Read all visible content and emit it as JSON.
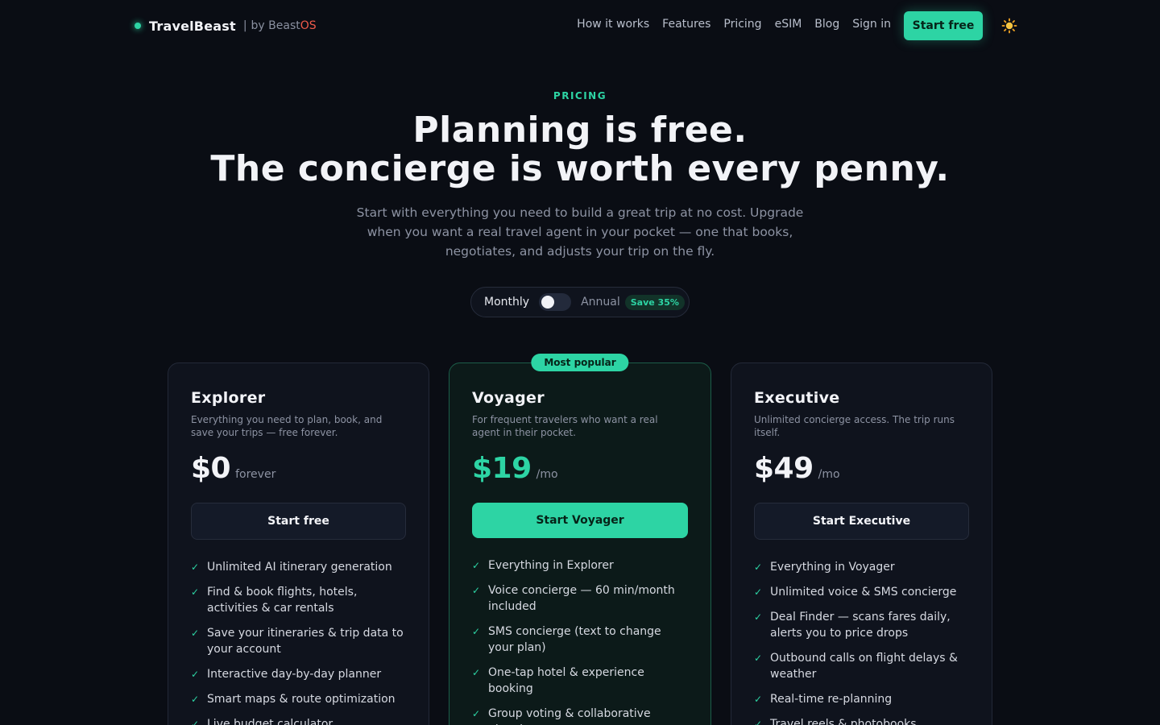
{
  "nav": {
    "brand": "TravelBeast",
    "separator": "|",
    "by_prefix": "by Beast",
    "by_suffix": "OS",
    "links": [
      "How it works",
      "Features",
      "Pricing",
      "eSIM",
      "Blog",
      "Sign in"
    ],
    "cta": "Start free",
    "theme_icon": "☀️"
  },
  "hero": {
    "eyebrow": "PRICING",
    "title_line1": "Planning is free.",
    "title_line2": "The concierge is worth every penny.",
    "subtitle": "Start with everything you need to build a great trip at no cost. Upgrade when you want a real travel agent in your pocket — one that books, negotiates, and adjusts your trip on the fly."
  },
  "billing": {
    "monthly_label": "Monthly",
    "annual_label": "Annual",
    "save_badge": "Save 35%",
    "annual_enabled": false
  },
  "plans": [
    {
      "name": "Explorer",
      "description": "Everything you need to plan, book, and save your trips — free forever.",
      "price": "$0",
      "unit": "forever",
      "button": "Start free",
      "features": [
        "Unlimited AI itinerary generation",
        "Find & book flights, hotels, activities & car rentals",
        "Save your itineraries & trip data to your account",
        "Interactive day-by-day planner",
        "Smart maps & route optimization",
        "Live budget calculator"
      ]
    },
    {
      "name": "Voyager",
      "badge": "Most popular",
      "description": "For frequent travelers who want a real agent in their pocket.",
      "price": "$19",
      "unit": "/mo",
      "button": "Start Voyager",
      "features": [
        "Everything in Explorer",
        "Voice concierge — 60 min/month included",
        "SMS concierge (text to change your plan)",
        "One-tap hotel & experience booking",
        "Group voting & collaborative planning"
      ]
    },
    {
      "name": "Executive",
      "description": "Unlimited concierge access. The trip runs itself.",
      "price": "$49",
      "unit": "/mo",
      "button": "Start Executive",
      "features": [
        "Everything in Voyager",
        "Unlimited voice & SMS concierge",
        "Deal Finder — scans fares daily, alerts you to price drops",
        "Outbound calls on flight delays & weather",
        "Real-time re-planning",
        "Travel reels & photobooks"
      ]
    }
  ],
  "colors": {
    "background": "#0a0d14",
    "accent": "#2dd4a4",
    "brand_os": "#ef5a4a"
  }
}
